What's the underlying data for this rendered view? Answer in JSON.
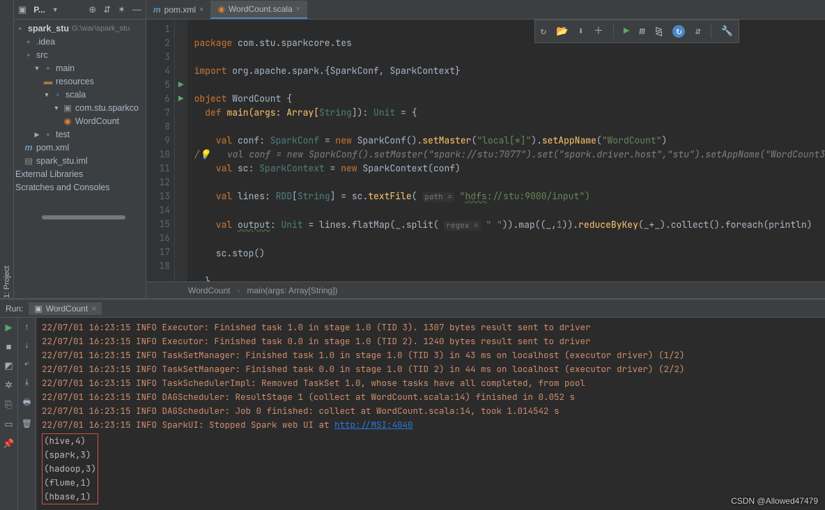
{
  "vertTab": "1: Project",
  "panelToolbar": {
    "title": "P...",
    "icons": [
      "target",
      "expand",
      "gear",
      "hide"
    ]
  },
  "tree": {
    "root": {
      "name": "spark_stu",
      "path": "G:\\war\\spark_stu"
    },
    "idea": ".idea",
    "src": "src",
    "main": "main",
    "resources": "resources",
    "scala": "scala",
    "pkg": "com.stu.sparkco",
    "wc": "WordCount",
    "test": "test",
    "pom": "pom.xml",
    "iml": "spark_stu.iml",
    "ext": "External Libraries",
    "scratch": "Scratches and Consoles"
  },
  "tabs": [
    {
      "icon": "m",
      "label": "pom.xml",
      "active": false
    },
    {
      "icon": "o",
      "label": "WordCount.scala",
      "active": true
    }
  ],
  "lineCount": 18,
  "breadcrumb": {
    "a": "WordCount",
    "b": "main(args: Array[String])"
  },
  "code": {
    "l1": {
      "kw": "package",
      "rest": " com.stu.sparkcore.tes"
    },
    "l3": {
      "kw": "import",
      "rest": " org.apache.spark.{SparkConf, SparkContext}"
    },
    "l5": {
      "kw": "object",
      "name": " WordCount {"
    },
    "l6": {
      "kw": "def",
      "sig": " main(args: Array[",
      "t": "String",
      "r2": "]): ",
      "t2": "Unit",
      "r3": " = {"
    },
    "l8": {
      "kw": "val",
      "a": " conf: ",
      "t": "SparkConf",
      "b": " = ",
      "kw2": "new",
      "c": " SparkConf().",
      "f1": "setMaster",
      "d": "(",
      "s1": "\"local[*]\"",
      "e": ").",
      "f2": "setAppName",
      "g": "(",
      "s2": "\"WordCount\"",
      "h": ")"
    },
    "l9": "   val conf = new SparkConf().setMaster(\"spark://stu:7077\").set(\"spark.driver.host\",\"stu\").setAppName(\"WordCount3",
    "l10": {
      "kw": "val",
      "a": " sc: ",
      "t": "SparkContext",
      "b": " = ",
      "kw2": "new",
      "c": " SparkContext(conf)"
    },
    "l12": {
      "kw": "val",
      "a": " lines: ",
      "t": "RDD",
      "g": "[",
      "t2": "String",
      "g2": "] = sc.",
      "f": "textFile",
      "p": "( ",
      "h": "path =",
      "s": " \"",
      "u": "hdfs",
      "s2": "://stu:9000/input\")"
    },
    "l14": {
      "kw": "val",
      "a": " ",
      "u": "output",
      "b": ": ",
      "t": "Unit",
      "c": " = lines.flatMap(_.split( ",
      "h": "regex =",
      "d": " ",
      "s": "\" \"",
      "e": ")).map((_,",
      "n": "1",
      "f": ")).",
      "fn": "reduceByKey",
      "g": "(_+_).collect().foreach(println)"
    },
    "l16": "sc.stop()",
    "l18": "  }"
  },
  "run": {
    "label": "Run:",
    "tab": "WordCount",
    "logs": [
      "22/07/01 16:23:15 INFO Executor: Finished task 1.0 in stage 1.0 (TID 3). 1307 bytes result sent to driver",
      "22/07/01 16:23:15 INFO Executor: Finished task 0.0 in stage 1.0 (TID 2). 1240 bytes result sent to driver",
      "22/07/01 16:23:15 INFO TaskSetManager: Finished task 1.0 in stage 1.0 (TID 3) in 43 ms on localhost (executor driver) (1/2)",
      "22/07/01 16:23:15 INFO TaskSetManager: Finished task 0.0 in stage 1.0 (TID 2) in 44 ms on localhost (executor driver) (2/2)",
      "22/07/01 16:23:15 INFO TaskSchedulerImpl: Removed TaskSet 1.0, whose tasks have all completed, from pool",
      "22/07/01 16:23:15 INFO DAGScheduler: ResultStage 1 (collect at WordCount.scala:14) finished in 0.052 s",
      "22/07/01 16:23:15 INFO DAGScheduler: Job 0 finished: collect at WordCount.scala:14, took 1.014542 s"
    ],
    "logLink": {
      "pre": "22/07/01 16:23:15 INFO SparkUI: Stopped Spark web UI at ",
      "link": "http://MSI:4040"
    },
    "results": [
      "(hive,4)",
      "(spark,3)",
      "(hadoop,3)",
      "(flume,1)",
      "(hbase,1)"
    ]
  },
  "watermark": "CSDN @Allowed47479"
}
